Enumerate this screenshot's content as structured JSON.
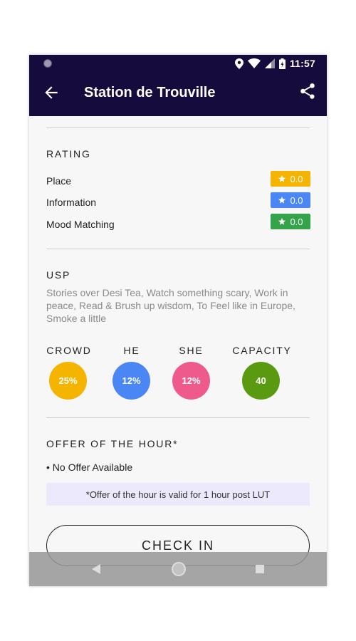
{
  "status_bar": {
    "time": "11:57",
    "icons": [
      "location-icon",
      "wifi-icon",
      "cell-signal-icon",
      "battery-charging-icon"
    ]
  },
  "app_bar": {
    "title": "Station de Trouville",
    "back_icon": "arrow-back-icon",
    "share_icon": "share-icon"
  },
  "rating": {
    "title": "RATING",
    "items": [
      {
        "label": "Place",
        "value": "0.0",
        "color": "#f4b400"
      },
      {
        "label": "Information",
        "value": "0.0",
        "color": "#4a86f4"
      },
      {
        "label": "Mood Matching",
        "value": "0.0",
        "color": "#34a34a"
      }
    ]
  },
  "usp": {
    "title": "USP",
    "text": "Stories over Desi Tea, Watch something scary, Work in peace, Read & Brush up wisdom, To Feel like in Europe, Smoke a little"
  },
  "stats": [
    {
      "label": "CROWD",
      "value": "25%",
      "color": "#f4b400"
    },
    {
      "label": "HE",
      "value": "12%",
      "color": "#4a86f4"
    },
    {
      "label": "SHE",
      "value": "12%",
      "color": "#ef5a8c"
    },
    {
      "label": "CAPACITY",
      "value": "40",
      "color": "#5a9a10"
    }
  ],
  "offer": {
    "title": "OFFER OF THE HOUR*",
    "item": "• No Offer Available",
    "note": "*Offer of the hour is valid for 1 hour post LUT"
  },
  "check_in_label": "CHECK IN"
}
